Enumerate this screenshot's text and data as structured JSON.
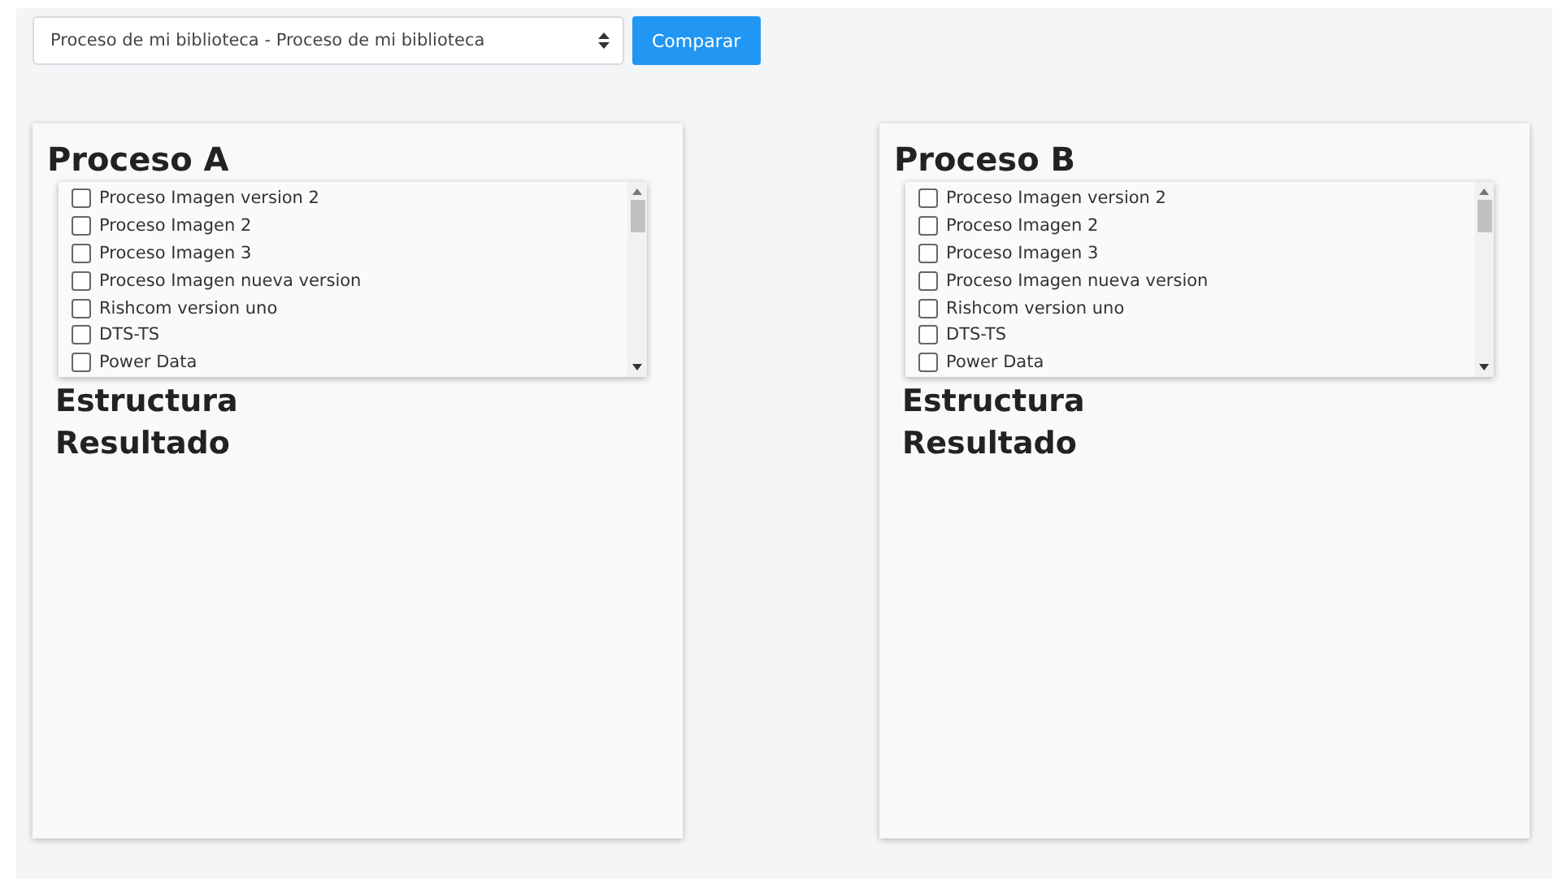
{
  "selector": {
    "value": "Proceso de mi biblioteca - Proceso de mi biblioteca"
  },
  "compare_button": {
    "label": "Comparar"
  },
  "panels": [
    {
      "title": "Proceso A",
      "items": [
        {
          "label": "Proceso Imagen version 2",
          "checked": false
        },
        {
          "label": "Proceso Imagen 2",
          "checked": false
        },
        {
          "label": "Proceso Imagen 3",
          "checked": false
        },
        {
          "label": "Proceso Imagen nueva version",
          "checked": false
        },
        {
          "label": "Rishcom version uno",
          "checked": false
        },
        {
          "label": "DTS-TS",
          "checked": false
        },
        {
          "label": "Power Data",
          "checked": false
        }
      ],
      "sections": [
        "Estructura",
        "Resultado"
      ]
    },
    {
      "title": "Proceso B",
      "items": [
        {
          "label": "Proceso Imagen version 2",
          "checked": false
        },
        {
          "label": "Proceso Imagen 2",
          "checked": false
        },
        {
          "label": "Proceso Imagen 3",
          "checked": false
        },
        {
          "label": "Proceso Imagen nueva version",
          "checked": false
        },
        {
          "label": "Rishcom version uno",
          "checked": false
        },
        {
          "label": "DTS-TS",
          "checked": false
        },
        {
          "label": "Power Data",
          "checked": false
        }
      ],
      "sections": [
        "Estructura",
        "Resultado"
      ]
    }
  ]
}
